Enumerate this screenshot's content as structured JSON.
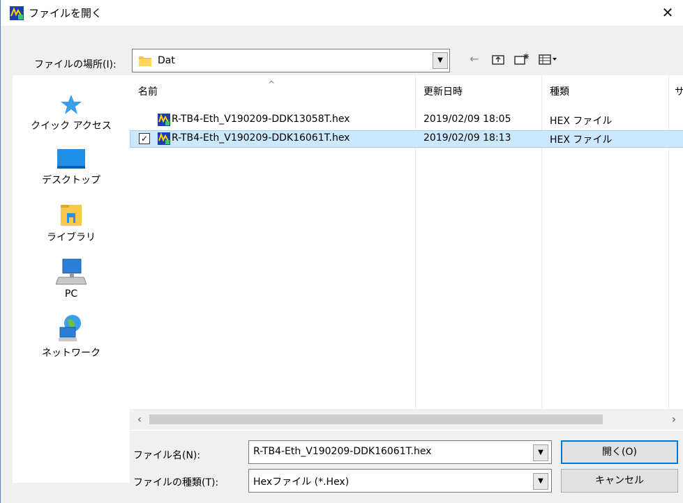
{
  "dialog": {
    "title": "ファイルを開く",
    "close_glyph": "✕"
  },
  "lookin": {
    "label": "ファイルの場所(I):",
    "value": "Dat"
  },
  "toolbar": {
    "back_glyph": "←",
    "up_folder_glyph": "⮥",
    "new_folder_glyph": "✱",
    "view_menu_glyph": "▦▾"
  },
  "places": [
    {
      "label": "クイック アクセス",
      "icon": "star-icon"
    },
    {
      "label": "デスクトップ",
      "icon": "desktop-icon"
    },
    {
      "label": "ライブラリ",
      "icon": "library-icon"
    },
    {
      "label": "PC",
      "icon": "pc-icon"
    },
    {
      "label": "ネットワーク",
      "icon": "network-icon"
    }
  ],
  "columns": {
    "name": "名前",
    "modified": "更新日時",
    "type": "種類",
    "size": "サ"
  },
  "files": [
    {
      "name": "R-TB4-Eth_V190209-DDK13058T.hex",
      "modified": "2019/02/09 18:05",
      "type": "HEX ファイル",
      "selected": false
    },
    {
      "name": "R-TB4-Eth_V190209-DDK16061T.hex",
      "modified": "2019/02/09 18:13",
      "type": "HEX ファイル",
      "selected": true
    }
  ],
  "filename": {
    "label": "ファイル名(N):",
    "value": "R-TB4-Eth_V190209-DDK16061T.hex"
  },
  "filetype": {
    "label": "ファイルの種類(T):",
    "value": "Hexファイル (*.Hex)"
  },
  "buttons": {
    "open": "開く(O)",
    "cancel": "キャンセル"
  },
  "colors": {
    "selection_bg": "#cce8ff",
    "selection_border": "#99d1ff",
    "default_button_border": "#0078d7"
  }
}
